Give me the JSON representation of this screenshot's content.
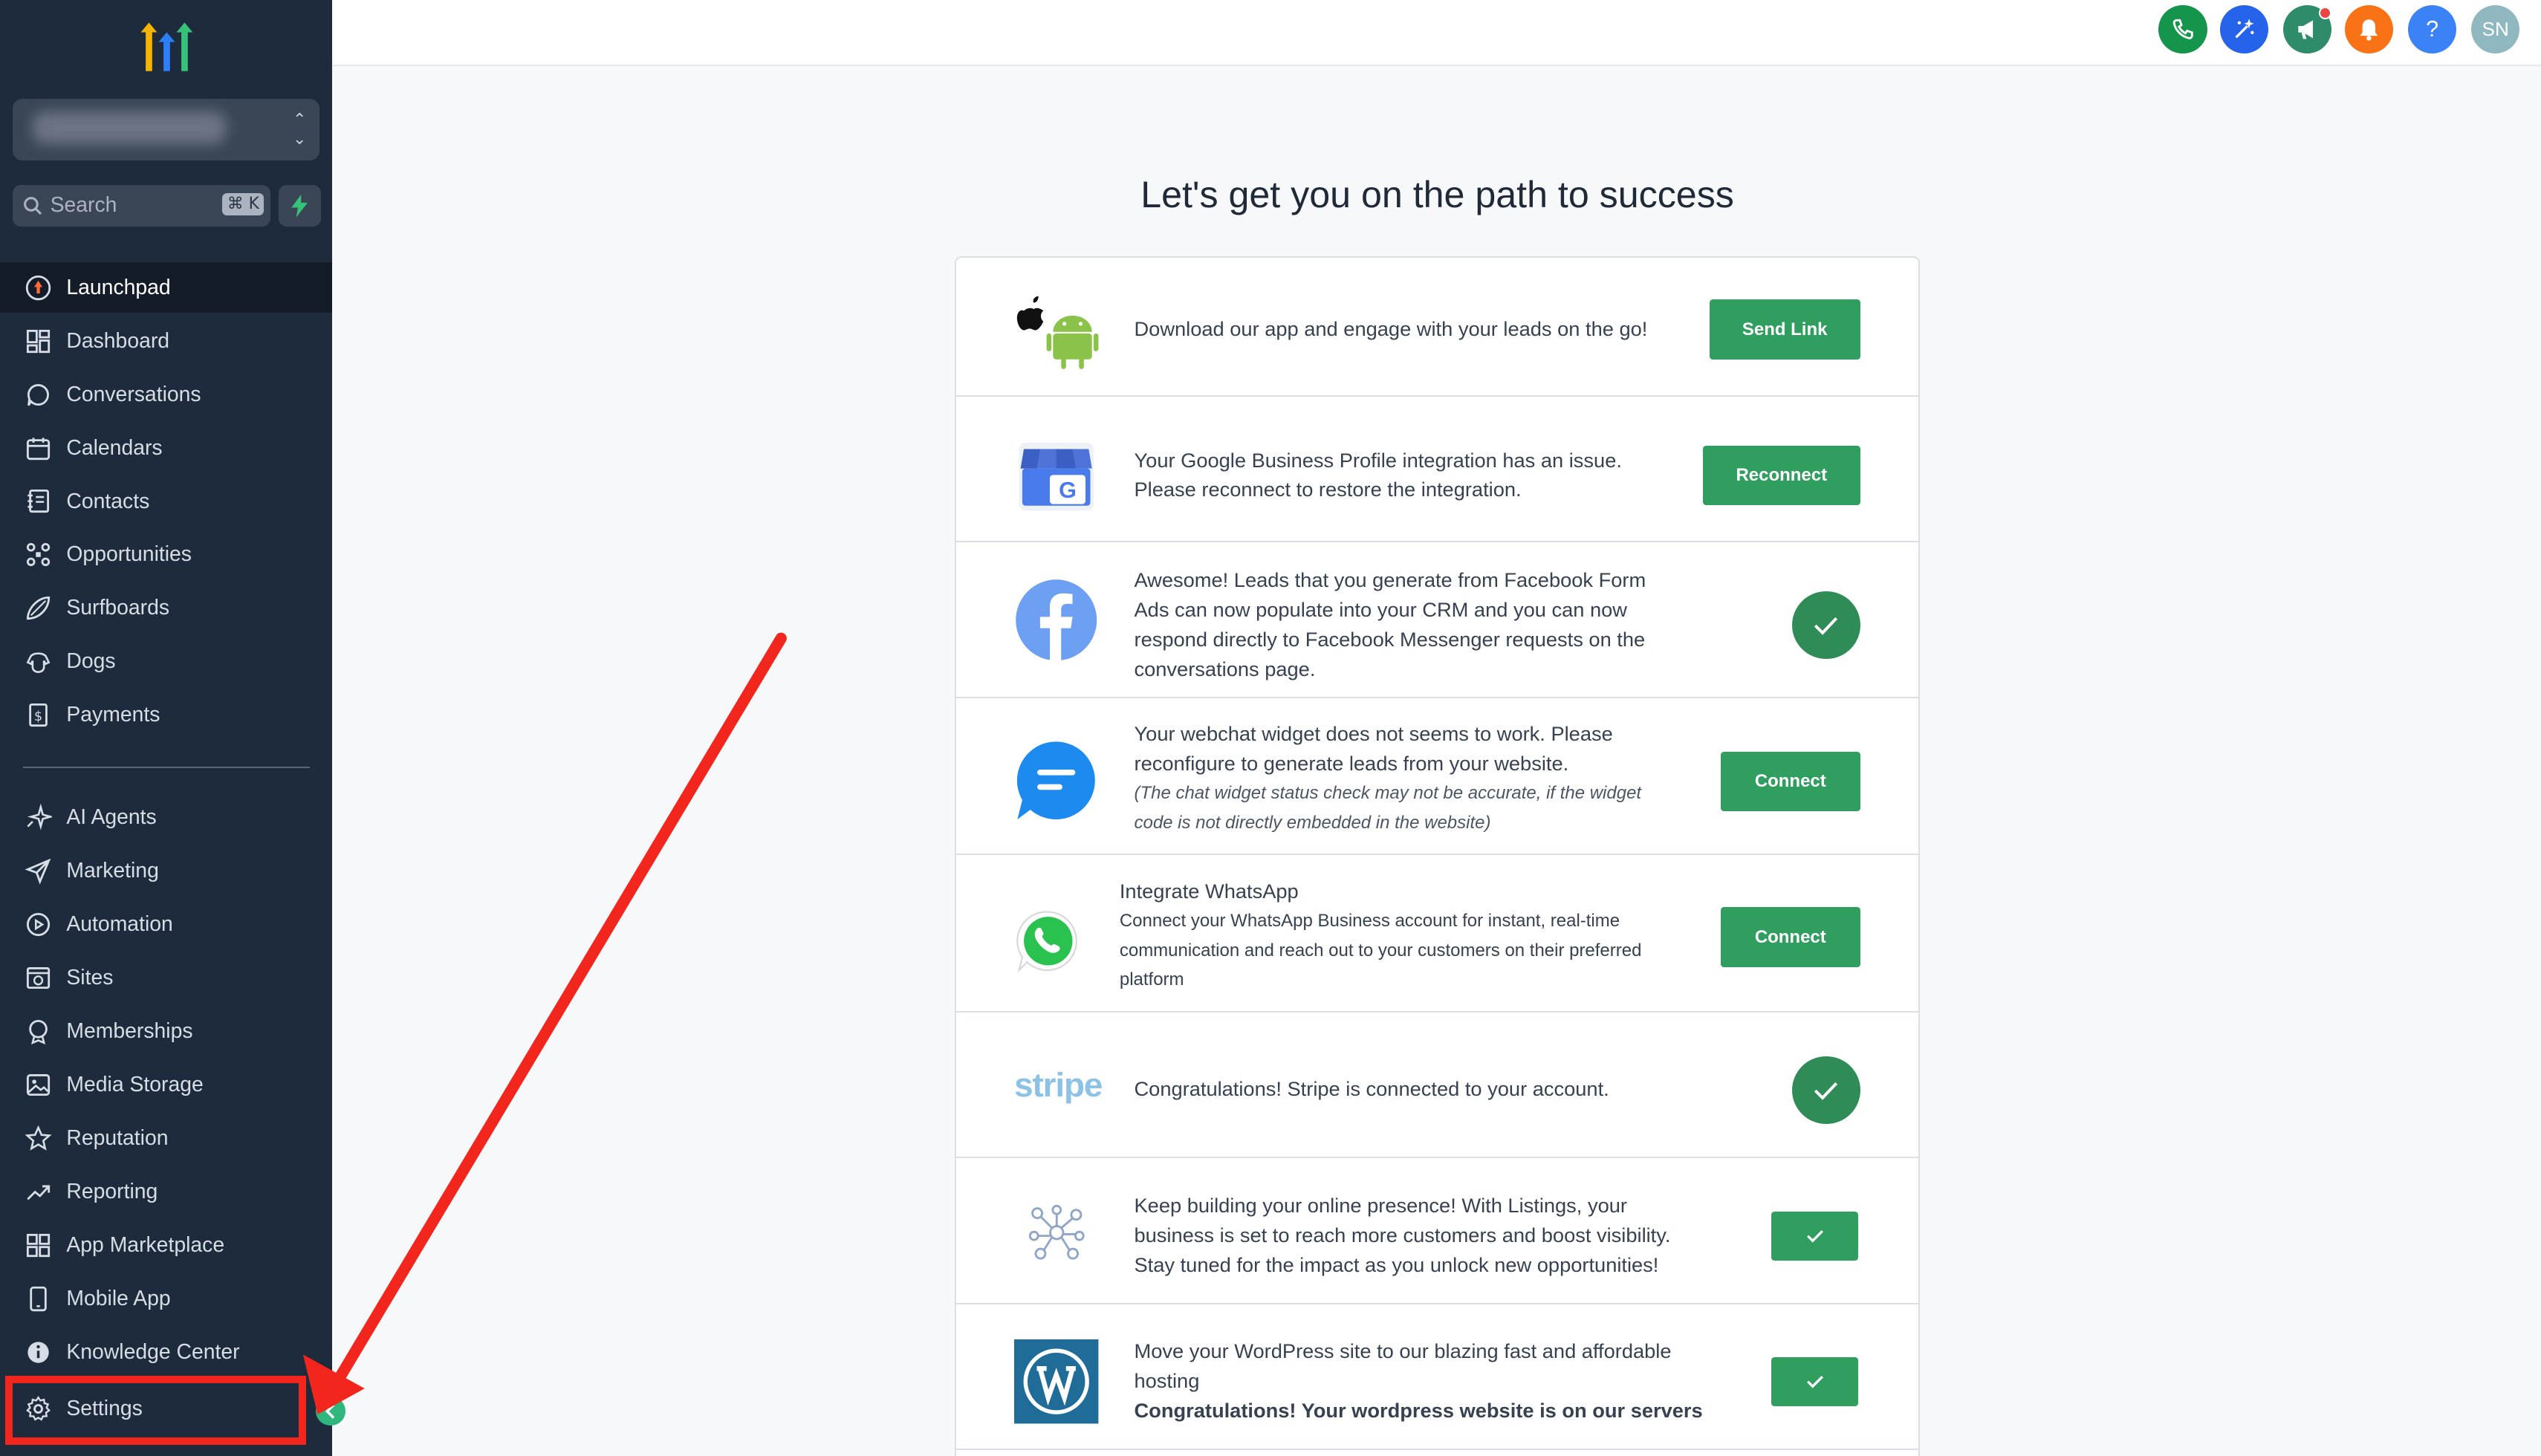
{
  "sidebar": {
    "search_placeholder": "Search",
    "search_shortcut": "⌘ K",
    "items": [
      {
        "label": "Launchpad",
        "icon": "rocket-icon"
      },
      {
        "label": "Dashboard",
        "icon": "dashboard-icon"
      },
      {
        "label": "Conversations",
        "icon": "chat-bubble-icon"
      },
      {
        "label": "Calendars",
        "icon": "calendar-icon"
      },
      {
        "label": "Contacts",
        "icon": "contacts-book-icon"
      },
      {
        "label": "Opportunities",
        "icon": "pipeline-icon"
      },
      {
        "label": "Surfboards",
        "icon": "surfboard-icon"
      },
      {
        "label": "Dogs",
        "icon": "dog-icon"
      },
      {
        "label": "Payments",
        "icon": "receipt-icon"
      },
      {
        "label": "AI Agents",
        "icon": "sparkle-icon"
      },
      {
        "label": "Marketing",
        "icon": "send-icon"
      },
      {
        "label": "Automation",
        "icon": "automation-icon"
      },
      {
        "label": "Sites",
        "icon": "globe-icon"
      },
      {
        "label": "Memberships",
        "icon": "membership-icon"
      },
      {
        "label": "Media Storage",
        "icon": "image-icon"
      },
      {
        "label": "Reputation",
        "icon": "star-icon"
      },
      {
        "label": "Reporting",
        "icon": "trend-icon"
      },
      {
        "label": "App Marketplace",
        "icon": "apps-grid-icon"
      },
      {
        "label": "Mobile App",
        "icon": "phone-icon"
      },
      {
        "label": "Knowledge Center",
        "icon": "info-icon"
      }
    ],
    "settings_label": "Settings"
  },
  "topbar": {
    "avatar_initials": "SN",
    "help_label": "?"
  },
  "main": {
    "title": "Let's get you on the path to success",
    "rows": [
      {
        "text": "Download our app and engage with your leads on the go!",
        "action": "Send Link"
      },
      {
        "text1": "Your Google Business Profile integration has an issue.",
        "text2": "Please reconnect to restore the integration.",
        "action": "Reconnect"
      },
      {
        "lines": [
          "Awesome! Leads that you generate from Facebook Form",
          "Ads can now populate into your CRM and you can now",
          "respond directly to Facebook Messenger requests on the",
          "conversations page."
        ]
      },
      {
        "lines": [
          "Your webchat widget does not seems to work. Please",
          "reconfigure to generate leads from your website."
        ],
        "note_lines": [
          "(The chat widget status check may not be accurate, if the widget",
          "code is not directly embedded in the website)"
        ],
        "action": "Connect"
      },
      {
        "heading": "Integrate WhatsApp",
        "lines": [
          "Connect your WhatsApp Business account for instant, real-time",
          "communication and reach out to your customers on their preferred",
          "platform"
        ],
        "action": "Connect"
      },
      {
        "logo_text": "stripe",
        "text": "Congratulations! Stripe is connected to your account."
      },
      {
        "lines": [
          "Keep building your online presence! With Listings, your",
          "business is set to reach more customers and boost visibility.",
          "Stay tuned for the impact as you unlock new opportunities!"
        ]
      },
      {
        "lines": [
          "Move your WordPress site to our blazing fast and affordable",
          "hosting"
        ],
        "bold": "Congratulations! Your wordpress website is on our servers"
      }
    ]
  },
  "colors": {
    "sidebar_bg": "#1e2b3c",
    "accent_green": "#2f9e5f",
    "annotation_red": "#f2261d"
  }
}
